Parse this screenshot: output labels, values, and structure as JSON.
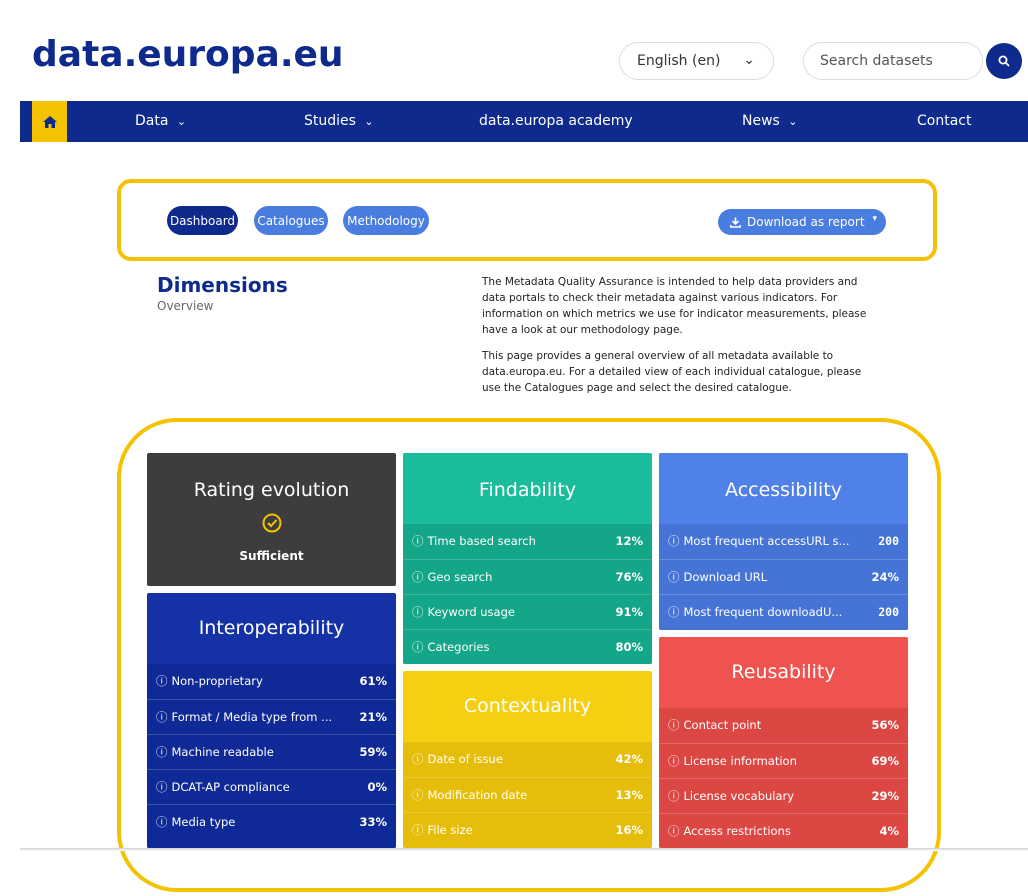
{
  "header": {
    "logo_text": "data.europa.eu",
    "language": "English (en)",
    "search_placeholder": "Search datasets"
  },
  "nav": {
    "items": [
      "Data",
      "Studies",
      "data.europa academy",
      "News",
      "Contact"
    ]
  },
  "tabs": {
    "dashboard": "Dashboard",
    "catalogues": "Catalogues",
    "methodology": "Methodology",
    "download": "Download as report"
  },
  "page": {
    "title": "Dimensions",
    "subtitle": "Overview",
    "para1": "The Metadata Quality Assurance is intended to help data providers and data portals to check their metadata against various indicators. For information on which metrics we use for indicator measurements, please have a look at our methodology page.",
    "para2": "This page provides a general overview of all metadata available to data.europa.eu. For a detailed view of each individual catalogue, please use the Catalogues page and select the desired catalogue."
  },
  "cards": {
    "rating": {
      "title": "Rating evolution",
      "status": "Sufficient"
    },
    "findability": {
      "title": "Findability",
      "rows": [
        {
          "label": "Time based search",
          "value": "12%"
        },
        {
          "label": "Geo search",
          "value": "76%"
        },
        {
          "label": "Keyword usage",
          "value": "91%"
        },
        {
          "label": "Categories",
          "value": "80%"
        }
      ]
    },
    "accessibility": {
      "title": "Accessibility",
      "rows": [
        {
          "label": "Most frequent accessURL s...",
          "value": "200"
        },
        {
          "label": "Download URL",
          "value": "24%"
        },
        {
          "label": "Most frequent downloadU...",
          "value": "200"
        }
      ]
    },
    "interoperability": {
      "title": "Interoperability",
      "rows": [
        {
          "label": "Non-proprietary",
          "value": "61%"
        },
        {
          "label": "Format / Media type from ...",
          "value": "21%"
        },
        {
          "label": "Machine readable",
          "value": "59%"
        },
        {
          "label": "DCAT-AP compliance",
          "value": "0%"
        },
        {
          "label": "Media type",
          "value": "33%"
        }
      ]
    },
    "contextuality": {
      "title": "Contextuality",
      "rows": [
        {
          "label": "Date of issue",
          "value": "42%"
        },
        {
          "label": "Modification date",
          "value": "13%"
        },
        {
          "label": "File size",
          "value": "16%"
        }
      ]
    },
    "reusability": {
      "title": "Reusability",
      "rows": [
        {
          "label": "Contact point",
          "value": "56%"
        },
        {
          "label": "License information",
          "value": "69%"
        },
        {
          "label": "License vocabulary",
          "value": "29%"
        },
        {
          "label": "Access restrictions",
          "value": "4%"
        }
      ]
    }
  },
  "colors": {
    "brand_blue": "#0e2a8c",
    "brand_yellow": "#f4c200",
    "rating": "#3d3d3d",
    "findability": "#1abc9c",
    "accessibility": "#4f81e8",
    "interoperability": "#1432a6",
    "contextuality": "#f4cf12",
    "reusability": "#ef5350"
  }
}
